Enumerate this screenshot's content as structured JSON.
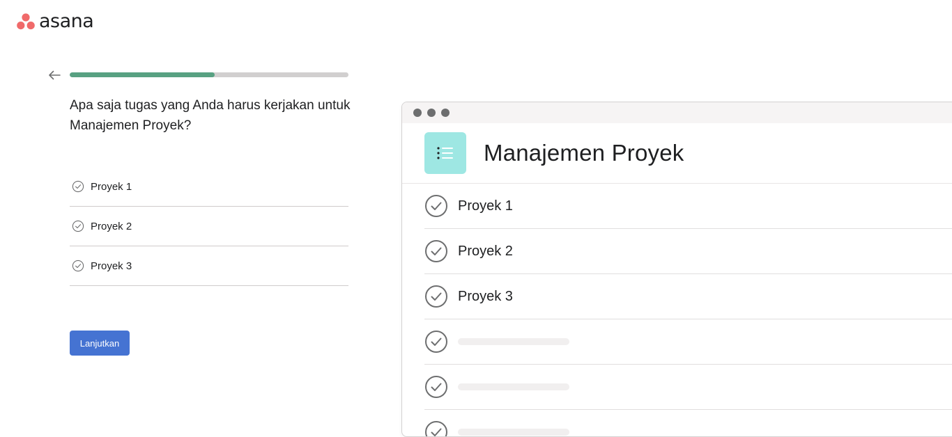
{
  "brand": {
    "name": "asana",
    "logo_color": "#f06a6a"
  },
  "onboarding": {
    "back_icon": "arrow-left-icon",
    "progress": {
      "fraction": 0.52,
      "fill_color": "#58a182",
      "track_color": "#d1cfcf"
    },
    "question": "Apa saja tugas yang Anda harus kerjakan untuk Manajemen Proyek?",
    "tasks": [
      {
        "label": "Proyek 1",
        "icon": "check-circle-icon"
      },
      {
        "label": "Proyek 2",
        "icon": "check-circle-icon"
      },
      {
        "label": "Proyek 3",
        "icon": "check-circle-icon"
      }
    ],
    "continue_label": "Lanjutkan",
    "continue_color": "#4573d2"
  },
  "preview": {
    "window_dots": 3,
    "project_icon": "list-icon",
    "project_icon_color": "#9ee7e3",
    "title": "Manajemen Proyek",
    "rows": [
      {
        "label": "Proyek 1"
      },
      {
        "label": "Proyek 2"
      },
      {
        "label": "Proyek 3"
      },
      {
        "label": ""
      },
      {
        "label": ""
      },
      {
        "label": ""
      }
    ]
  }
}
